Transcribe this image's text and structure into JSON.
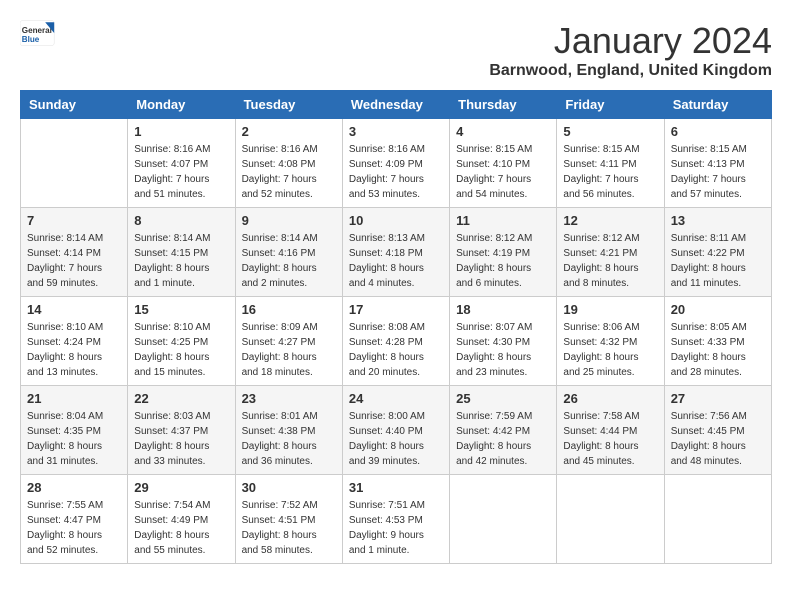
{
  "logo": {
    "text_general": "General",
    "text_blue": "Blue"
  },
  "title": "January 2024",
  "subtitle": "Barnwood, England, United Kingdom",
  "days_of_week": [
    "Sunday",
    "Monday",
    "Tuesday",
    "Wednesday",
    "Thursday",
    "Friday",
    "Saturday"
  ],
  "weeks": [
    [
      {
        "day": "",
        "info": ""
      },
      {
        "day": "1",
        "info": "Sunrise: 8:16 AM\nSunset: 4:07 PM\nDaylight: 7 hours\nand 51 minutes."
      },
      {
        "day": "2",
        "info": "Sunrise: 8:16 AM\nSunset: 4:08 PM\nDaylight: 7 hours\nand 52 minutes."
      },
      {
        "day": "3",
        "info": "Sunrise: 8:16 AM\nSunset: 4:09 PM\nDaylight: 7 hours\nand 53 minutes."
      },
      {
        "day": "4",
        "info": "Sunrise: 8:15 AM\nSunset: 4:10 PM\nDaylight: 7 hours\nand 54 minutes."
      },
      {
        "day": "5",
        "info": "Sunrise: 8:15 AM\nSunset: 4:11 PM\nDaylight: 7 hours\nand 56 minutes."
      },
      {
        "day": "6",
        "info": "Sunrise: 8:15 AM\nSunset: 4:13 PM\nDaylight: 7 hours\nand 57 minutes."
      }
    ],
    [
      {
        "day": "7",
        "info": "Sunrise: 8:14 AM\nSunset: 4:14 PM\nDaylight: 7 hours\nand 59 minutes."
      },
      {
        "day": "8",
        "info": "Sunrise: 8:14 AM\nSunset: 4:15 PM\nDaylight: 8 hours\nand 1 minute."
      },
      {
        "day": "9",
        "info": "Sunrise: 8:14 AM\nSunset: 4:16 PM\nDaylight: 8 hours\nand 2 minutes."
      },
      {
        "day": "10",
        "info": "Sunrise: 8:13 AM\nSunset: 4:18 PM\nDaylight: 8 hours\nand 4 minutes."
      },
      {
        "day": "11",
        "info": "Sunrise: 8:12 AM\nSunset: 4:19 PM\nDaylight: 8 hours\nand 6 minutes."
      },
      {
        "day": "12",
        "info": "Sunrise: 8:12 AM\nSunset: 4:21 PM\nDaylight: 8 hours\nand 8 minutes."
      },
      {
        "day": "13",
        "info": "Sunrise: 8:11 AM\nSunset: 4:22 PM\nDaylight: 8 hours\nand 11 minutes."
      }
    ],
    [
      {
        "day": "14",
        "info": "Sunrise: 8:10 AM\nSunset: 4:24 PM\nDaylight: 8 hours\nand 13 minutes."
      },
      {
        "day": "15",
        "info": "Sunrise: 8:10 AM\nSunset: 4:25 PM\nDaylight: 8 hours\nand 15 minutes."
      },
      {
        "day": "16",
        "info": "Sunrise: 8:09 AM\nSunset: 4:27 PM\nDaylight: 8 hours\nand 18 minutes."
      },
      {
        "day": "17",
        "info": "Sunrise: 8:08 AM\nSunset: 4:28 PM\nDaylight: 8 hours\nand 20 minutes."
      },
      {
        "day": "18",
        "info": "Sunrise: 8:07 AM\nSunset: 4:30 PM\nDaylight: 8 hours\nand 23 minutes."
      },
      {
        "day": "19",
        "info": "Sunrise: 8:06 AM\nSunset: 4:32 PM\nDaylight: 8 hours\nand 25 minutes."
      },
      {
        "day": "20",
        "info": "Sunrise: 8:05 AM\nSunset: 4:33 PM\nDaylight: 8 hours\nand 28 minutes."
      }
    ],
    [
      {
        "day": "21",
        "info": "Sunrise: 8:04 AM\nSunset: 4:35 PM\nDaylight: 8 hours\nand 31 minutes."
      },
      {
        "day": "22",
        "info": "Sunrise: 8:03 AM\nSunset: 4:37 PM\nDaylight: 8 hours\nand 33 minutes."
      },
      {
        "day": "23",
        "info": "Sunrise: 8:01 AM\nSunset: 4:38 PM\nDaylight: 8 hours\nand 36 minutes."
      },
      {
        "day": "24",
        "info": "Sunrise: 8:00 AM\nSunset: 4:40 PM\nDaylight: 8 hours\nand 39 minutes."
      },
      {
        "day": "25",
        "info": "Sunrise: 7:59 AM\nSunset: 4:42 PM\nDaylight: 8 hours\nand 42 minutes."
      },
      {
        "day": "26",
        "info": "Sunrise: 7:58 AM\nSunset: 4:44 PM\nDaylight: 8 hours\nand 45 minutes."
      },
      {
        "day": "27",
        "info": "Sunrise: 7:56 AM\nSunset: 4:45 PM\nDaylight: 8 hours\nand 48 minutes."
      }
    ],
    [
      {
        "day": "28",
        "info": "Sunrise: 7:55 AM\nSunset: 4:47 PM\nDaylight: 8 hours\nand 52 minutes."
      },
      {
        "day": "29",
        "info": "Sunrise: 7:54 AM\nSunset: 4:49 PM\nDaylight: 8 hours\nand 55 minutes."
      },
      {
        "day": "30",
        "info": "Sunrise: 7:52 AM\nSunset: 4:51 PM\nDaylight: 8 hours\nand 58 minutes."
      },
      {
        "day": "31",
        "info": "Sunrise: 7:51 AM\nSunset: 4:53 PM\nDaylight: 9 hours\nand 1 minute."
      },
      {
        "day": "",
        "info": ""
      },
      {
        "day": "",
        "info": ""
      },
      {
        "day": "",
        "info": ""
      }
    ]
  ]
}
